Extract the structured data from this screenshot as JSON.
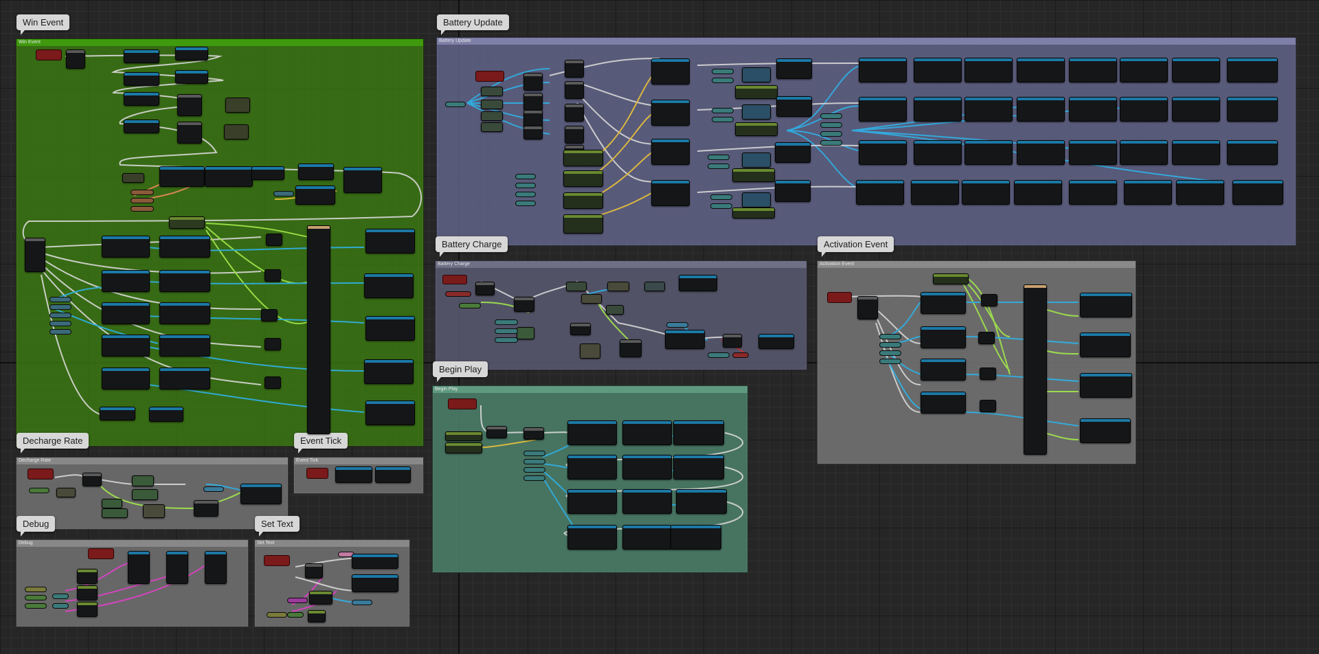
{
  "comments": [
    {
      "id": "win-event",
      "title": "Win Event",
      "header": "Win Event",
      "color": "#3c7e0f"
    },
    {
      "id": "battery-update",
      "title": "Battery Update",
      "header": "Battery Update",
      "color": "#6d6f8c"
    },
    {
      "id": "battery-charge",
      "title": "Battery Charge",
      "header": "Battery Charge",
      "color": "#585868"
    },
    {
      "id": "activation-event",
      "title": "Activation Event",
      "header": "Activation Event",
      "color": "#6e6e6e"
    },
    {
      "id": "begin-play",
      "title": "Begin Play",
      "header": "Begin Play",
      "color": "#4d7d68"
    },
    {
      "id": "decharge-rate",
      "title": "Decharge Rate",
      "header": "Decharge Rate",
      "color": "#6a6a6a"
    },
    {
      "id": "event-tick",
      "title": "Event Tick",
      "header": "Event Tick",
      "color": "#6a6a6a"
    },
    {
      "id": "debug",
      "title": "Debug",
      "header": "Debug",
      "color": "#6a6a6a"
    },
    {
      "id": "set-text",
      "title": "Set Text",
      "header": "Set Text",
      "color": "#6a6a6a"
    }
  ],
  "colors": {
    "exec_wire": "#d8d8d8",
    "float_wire": "#2fb1e6",
    "bool_wire": "#a2e84c",
    "object_wire": "#e8c23a",
    "string_wire": "#e040c8",
    "event_node": "#8a1a1a"
  }
}
